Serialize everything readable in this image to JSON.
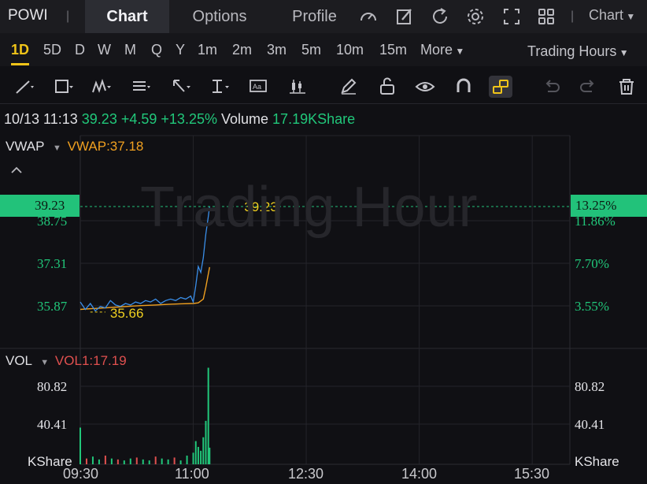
{
  "header": {
    "ticker": "POWI",
    "separator": "|",
    "tabs": [
      {
        "label": "Chart",
        "active": true
      },
      {
        "label": "Options",
        "active": false
      },
      {
        "label": "Profile",
        "active": false
      }
    ],
    "tool_icons": [
      "gauge-icon",
      "edit-icon",
      "refresh-icon",
      "settings-icon",
      "fullscreen-icon",
      "grid-icon"
    ],
    "chart_menu": "Chart"
  },
  "periods": {
    "items": [
      "1D",
      "5D",
      "D",
      "W",
      "M",
      "Q",
      "Y",
      "1m",
      "2m",
      "3m",
      "5m",
      "10m",
      "15m",
      "More"
    ],
    "active": "1D",
    "session": "Trading Hours"
  },
  "drawing_tools": [
    "line-tool-icon",
    "rectangle-tool-icon",
    "pattern-tool-icon",
    "fib-tool-icon",
    "arrow-tool-icon",
    "measure-tool-icon",
    "text-tool-icon",
    "candle-tool-icon",
    "pencil-icon",
    "unlock-icon",
    "eye-icon",
    "magnet-icon",
    "link-icon",
    "undo-icon",
    "redo-icon",
    "trash-icon"
  ],
  "quote": {
    "datetime": "10/13 11:13",
    "price": "39.23",
    "change": "+4.59",
    "change_pct": "+13.25%",
    "volume_label": "Volume",
    "volume_value": "17.19KShare"
  },
  "price_panel": {
    "indicator": "VWAP",
    "indicator_value": "VWAP:37.18",
    "watermark": "Trading Hour",
    "left_ticks": [
      "38.75",
      "37.31",
      "35.87"
    ],
    "right_ticks": [
      "11.86%",
      "7.70%",
      "3.55%"
    ],
    "last_price_tag": "39.23",
    "last_pct_tag": "13.25%",
    "last_price_label": "39.23",
    "low_label": "35.66"
  },
  "volume_panel": {
    "indicator": "VOL",
    "indicator_value": "VOL1:17.19",
    "left_ticks": [
      "80.82",
      "40.41",
      "KShare"
    ],
    "right_ticks": [
      "80.82",
      "40.41",
      "KShare"
    ]
  },
  "time_axis": [
    "09:30",
    "11:00",
    "12:30",
    "14:00",
    "15:30"
  ],
  "colors": {
    "up": "#21c77a",
    "down": "#e0504f",
    "price_line": "#3a8ee8",
    "vwap_line": "#f0a020",
    "accent": "#f0c419"
  },
  "chart_data": {
    "type": "line",
    "title": "",
    "xlabel": "",
    "ylabel": "",
    "x_range": [
      "09:30",
      "16:00"
    ],
    "ylim": [
      35.3,
      39.9
    ],
    "series": [
      {
        "name": "",
        "x": [
          "09:30",
          "09:34",
          "09:38",
          "09:42",
          "09:46",
          "09:50",
          "09:54",
          "09:58",
          "10:02",
          "10:06",
          "10:10",
          "10:14",
          "10:18",
          "10:22",
          "10:26",
          "10:30",
          "10:34",
          "10:38",
          "10:42",
          "10:46",
          "10:50",
          "10:54",
          "10:58",
          "11:00",
          "11:02",
          "11:04",
          "11:06",
          "11:08",
          "11:10",
          "11:12",
          "11:13"
        ],
        "values": [
          36.0,
          35.75,
          35.95,
          35.7,
          35.85,
          35.8,
          36.05,
          35.9,
          35.85,
          35.95,
          35.9,
          36.0,
          35.95,
          36.05,
          36.0,
          36.1,
          35.95,
          36.05,
          36.1,
          36.05,
          36.15,
          36.1,
          36.2,
          36.0,
          36.55,
          37.2,
          37.0,
          37.5,
          38.3,
          38.9,
          39.23
        ]
      },
      {
        "name": "VWAP",
        "x": [
          "09:30",
          "09:40",
          "09:50",
          "10:00",
          "10:10",
          "10:20",
          "10:30",
          "10:40",
          "10:50",
          "11:00",
          "11:04",
          "11:08",
          "11:10",
          "11:13"
        ],
        "values": [
          35.75,
          35.78,
          35.8,
          35.83,
          35.86,
          35.88,
          35.9,
          35.92,
          35.94,
          35.95,
          35.97,
          36.1,
          36.5,
          37.18
        ]
      }
    ],
    "volume": {
      "unit": "KShare",
      "ylim": [
        0,
        100
      ],
      "x": [
        "09:30",
        "09:35",
        "09:40",
        "09:45",
        "09:50",
        "09:55",
        "10:00",
        "10:05",
        "10:10",
        "10:15",
        "10:20",
        "10:25",
        "10:30",
        "10:35",
        "10:40",
        "10:45",
        "10:50",
        "10:55",
        "11:00",
        "11:02",
        "11:04",
        "11:06",
        "11:08",
        "11:10",
        "11:12",
        "11:13"
      ],
      "values": [
        38,
        6,
        8,
        5,
        9,
        6,
        5,
        4,
        6,
        7,
        5,
        4,
        8,
        6,
        5,
        7,
        4,
        9,
        12,
        24,
        18,
        14,
        28,
        45,
        120,
        17.19
      ],
      "up": [
        true,
        false,
        true,
        true,
        false,
        true,
        false,
        true,
        true,
        false,
        true,
        true,
        false,
        true,
        true,
        false,
        true,
        true,
        true,
        true,
        true,
        true,
        true,
        true,
        true,
        true
      ]
    }
  }
}
